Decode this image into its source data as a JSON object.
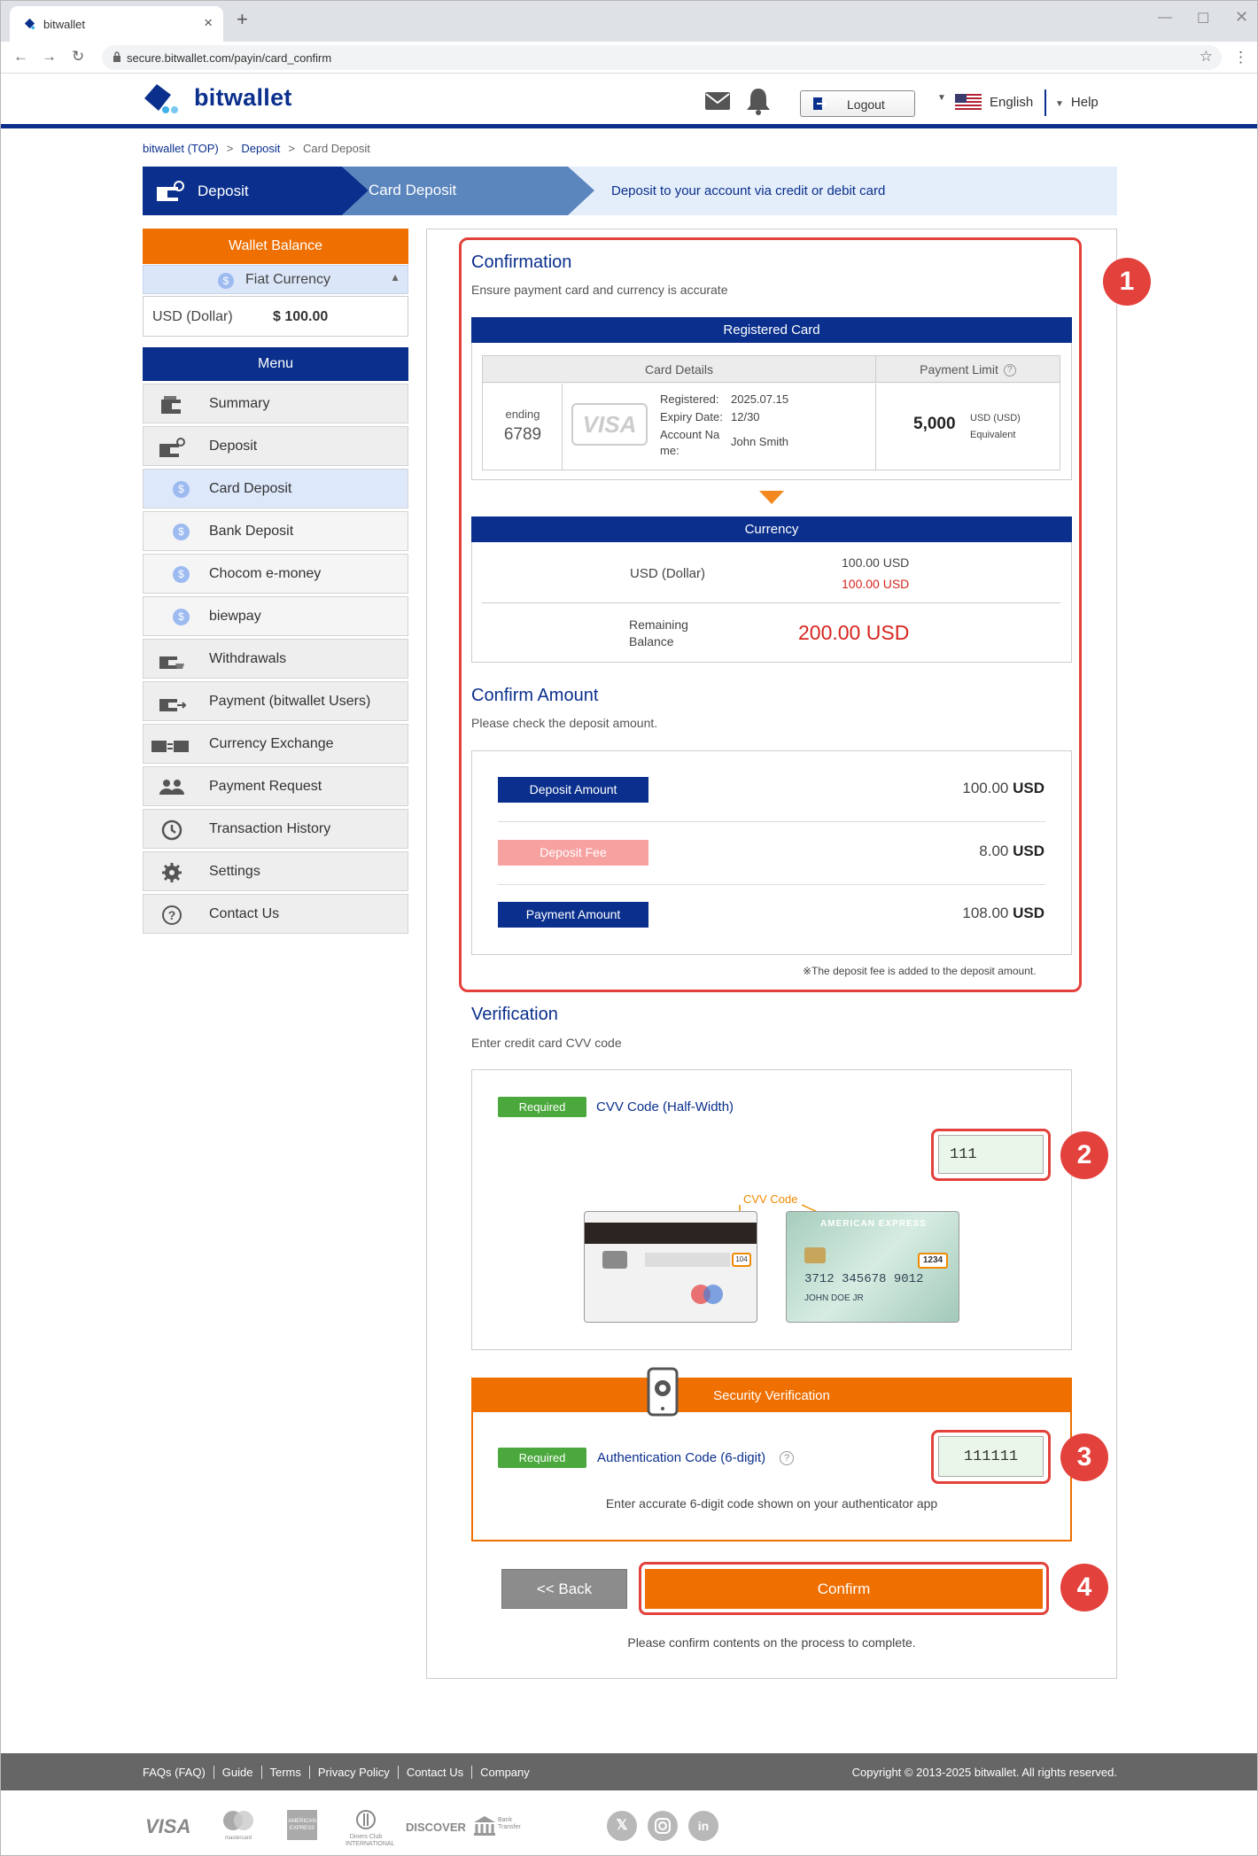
{
  "browser": {
    "tab_title": "bitwallet",
    "url": "secure.bitwallet.com/payin/card_confirm"
  },
  "header": {
    "logo_text": "bitwallet",
    "logout_label": "Logout",
    "language": "English",
    "help": "Help"
  },
  "breadcrumb": {
    "top": "bitwallet (TOP)",
    "deposit": "Deposit",
    "current": "Card Deposit"
  },
  "banner": {
    "step1": "Deposit",
    "step2": "Card Deposit",
    "description": "Deposit to your account via credit or debit card"
  },
  "sidebar": {
    "wallet_balance_title": "Wallet Balance",
    "fiat_label": "Fiat Currency",
    "currency": "USD (Dollar)",
    "balance": "$ 100.00",
    "menu_title": "Menu",
    "items": [
      {
        "label": "Summary",
        "icon": "wallet-icon"
      },
      {
        "label": "Deposit",
        "icon": "deposit-icon"
      },
      {
        "label": "Card Deposit",
        "icon": "dollar-icon"
      },
      {
        "label": "Bank Deposit",
        "icon": "dollar-icon"
      },
      {
        "label": "Chocom e-money",
        "icon": "dollar-icon"
      },
      {
        "label": "biewpay",
        "icon": "dollar-icon"
      },
      {
        "label": "Withdrawals",
        "icon": "withdraw-icon"
      },
      {
        "label": "Payment (bitwallet Users)",
        "icon": "payment-icon"
      },
      {
        "label": "Currency Exchange",
        "icon": "exchange-icon"
      },
      {
        "label": "Payment Request",
        "icon": "users-icon"
      },
      {
        "label": "Transaction History",
        "icon": "history-icon"
      },
      {
        "label": "Settings",
        "icon": "gear-icon"
      },
      {
        "label": "Contact Us",
        "icon": "question-icon"
      }
    ]
  },
  "confirmation": {
    "title": "Confirmation",
    "subtitle": "Ensure payment card and currency is accurate",
    "registered_card": "Registered Card",
    "col_details": "Card Details",
    "col_limit": "Payment Limit",
    "ending_label": "ending",
    "ending_digits": "6789",
    "card_brand": "VISA",
    "registered_label": "Registered:",
    "registered_value": "2025.07.15",
    "expiry_label": "Expiry Date:",
    "expiry_value": "12/30",
    "account_label_1": "Account Na",
    "account_label_2": "me:",
    "account_value": "John Smith",
    "limit_value": "5,000",
    "limit_unit_1": "USD (USD)",
    "limit_unit_2": "Equivalent",
    "currency_bar": "Currency",
    "currency_name": "USD (Dollar)",
    "currency_amount_1": "100.00 USD",
    "currency_amount_2": "100.00 USD",
    "remaining_label_1": "Remaining",
    "remaining_label_2": "Balance",
    "remaining_value": "200.00 USD"
  },
  "confirm_amount": {
    "title": "Confirm Amount",
    "subtitle": "Please check the deposit amount.",
    "deposit_label": "Deposit Amount",
    "deposit_value": "100.00",
    "fee_label": "Deposit Fee",
    "fee_value": "8.00",
    "payment_label": "Payment Amount",
    "payment_value": "108.00",
    "unit": "USD",
    "note": "※The deposit fee is added to the deposit amount."
  },
  "verification": {
    "title": "Verification",
    "subtitle": "Enter credit card CVV code",
    "required": "Required",
    "cvv_label": "CVV Code (Half-Width)",
    "cvv_value": "111",
    "cvv_callout": "CVV Code",
    "card1_cvv": "104",
    "card2_cvv": "1234",
    "card2_brand": "AMERICAN EXPRESS",
    "card2_number": "3712 345678 9012",
    "card2_name": "JOHN DOE JR"
  },
  "security": {
    "title": "Security Verification",
    "required": "Required",
    "auth_label": "Authentication Code (6-digit)",
    "auth_value": "111111",
    "hint": "Enter accurate 6-digit code shown on your authenticator app"
  },
  "actions": {
    "back": "<< Back",
    "confirm": "Confirm",
    "final_note": "Please confirm contents on the process to complete."
  },
  "annotations": [
    "1",
    "2",
    "3",
    "4"
  ],
  "footer": {
    "links": [
      "FAQs (FAQ)",
      "Guide",
      "Terms",
      "Privacy Policy",
      "Contact Us",
      "Company"
    ],
    "copyright": "Copyright © 2013-2025 bitwallet. All rights reserved.",
    "payment_logos": [
      "VISA",
      "mastercard",
      "AMERICAN EXPRESS",
      "Diners Club INTERNATIONAL",
      "DISCOVER",
      "Bank Transfer"
    ]
  },
  "colors": {
    "brand_blue": "#0a2f8c",
    "orange": "#ef6f00",
    "annotation_red": "#e3413c",
    "required_green": "#4aa83c"
  }
}
